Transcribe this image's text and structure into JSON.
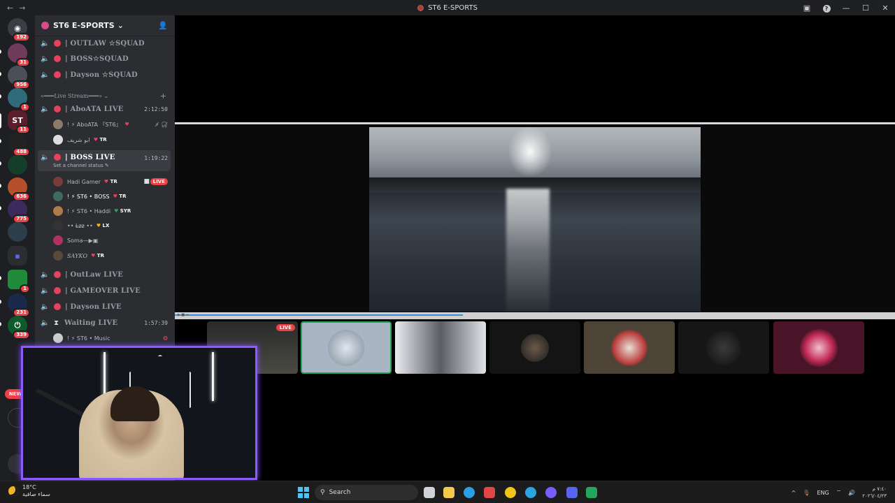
{
  "window": {
    "title": "ST6 E-SPORTS",
    "back": "←",
    "forward": "→",
    "inbox_icon": "inbox-icon",
    "help_label": "?",
    "minimize": "—",
    "maximize": "☐",
    "close": "✕"
  },
  "servers": [
    {
      "glyph": "◉",
      "badge": "192"
    },
    {
      "glyph": "",
      "badge": "31"
    },
    {
      "glyph": "",
      "badge": "956"
    },
    {
      "glyph": "",
      "badge": "1"
    },
    {
      "glyph": "ST",
      "badge": "11"
    },
    {
      "glyph": "",
      "badge": "488"
    },
    {
      "glyph": "",
      "badge": ""
    },
    {
      "glyph": "",
      "badge": "636"
    },
    {
      "glyph": "",
      "badge": "775"
    },
    {
      "glyph": "",
      "badge": ""
    },
    {
      "glyph": "▪",
      "badge": ""
    },
    {
      "glyph": "",
      "badge": "1"
    },
    {
      "glyph": "",
      "badge": "231"
    },
    {
      "glyph": "⏻",
      "badge": "339"
    }
  ],
  "new_badge": "NEW",
  "guild": {
    "name": "ST6 E-SPORTS",
    "chevron": "⌄",
    "invite_icon": "add-member-icon"
  },
  "channels_top": [
    {
      "name": "| OUTLAW ☆SQUAD"
    },
    {
      "name": "| BOSS☆SQUAD"
    },
    {
      "name": "| Dayson ☆SQUAD"
    }
  ],
  "category": {
    "name": "«━━━Live Stream━━━» ⌄",
    "plus": "+"
  },
  "live_channels": [
    {
      "name": "| AboATA LIVE",
      "time": "2:12:50",
      "users": [
        {
          "name": "! ⚡ AboATA 『ST6』",
          "tag": "",
          "right": "⚡̸ 🎧̸"
        },
        {
          "name": "ابو شريف",
          "tag": "TR",
          "right": ""
        }
      ]
    },
    {
      "name": "| BOSS LIVE",
      "time": "1:19:22",
      "status": "Set a channel status ✎",
      "users": [
        {
          "name": "Hadi Gamer",
          "tag": "TR",
          "right": "LIVE"
        },
        {
          "name": "! ⚡ ST6 • BOSS",
          "tag": "TR",
          "right": ""
        },
        {
          "name": "! ⚡ ST6 • Haddi",
          "tag": "SYR",
          "right": ""
        },
        {
          "name": "•• L̶z̶z̶ ••",
          "tag": "LX",
          "right": ""
        },
        {
          "name": "Soma—▶▣",
          "tag": "",
          "right": ""
        },
        {
          "name": "𝑆𝐴𝑌𝐾𝑂",
          "tag": "TR",
          "right": ""
        }
      ]
    }
  ],
  "channels_bottom": [
    {
      "name": "| OutLaw LIVE",
      "time": ""
    },
    {
      "name": "| GAMEOVER LIVE",
      "time": ""
    },
    {
      "name": "| Dayson LIVE",
      "time": ""
    },
    {
      "name": "Waiting LIVE",
      "time": "1:57:39"
    }
  ],
  "music_user": {
    "name": "! ⚡ ST6 • Music"
  },
  "player": {
    "progress": 0.4,
    "live_label": "LIVE"
  },
  "tiles": [
    {
      "kind": "stream",
      "live": "LIVE"
    },
    {
      "kind": "avatar"
    },
    {
      "kind": "camera"
    },
    {
      "kind": "avatar"
    },
    {
      "kind": "avatar"
    },
    {
      "kind": "avatar"
    },
    {
      "kind": "avatar"
    }
  ],
  "taskbar": {
    "temp": "18°C",
    "weather_text": "سماء صافية",
    "search_placeholder": "Search",
    "lang": "ENG",
    "time": "٧:٤٠ م",
    "date": "٢٠٢٦/٠٤/٢٣"
  }
}
